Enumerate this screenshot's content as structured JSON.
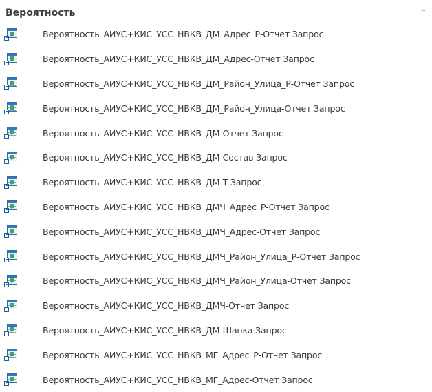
{
  "group": {
    "title": "Вероятность",
    "collapse_icon": "collapse-arrow-icon"
  },
  "items": [
    {
      "label": "Вероятность_АИУС+КИС_УСС_НВКВ_ДМ_Адрес_Р-Отчет Запрос",
      "icon": "query-shortcut-icon"
    },
    {
      "label": "Вероятность_АИУС+КИС_УСС_НВКВ_ДМ_Адрес-Отчет Запрос",
      "icon": "query-shortcut-icon"
    },
    {
      "label": "Вероятность_АИУС+КИС_УСС_НВКВ_ДМ_Район_Улица_Р-Отчет Запрос",
      "icon": "query-shortcut-icon"
    },
    {
      "label": "Вероятность_АИУС+КИС_УСС_НВКВ_ДМ_Район_Улица-Отчет Запрос",
      "icon": "query-shortcut-icon"
    },
    {
      "label": "Вероятность_АИУС+КИС_УСС_НВКВ_ДМ-Отчет Запрос",
      "icon": "query-shortcut-icon"
    },
    {
      "label": "Вероятность_АИУС+КИС_УСС_НВКВ_ДМ-Состав Запрос",
      "icon": "query-shortcut-icon"
    },
    {
      "label": "Вероятность_АИУС+КИС_УСС_НВКВ_ДМ-Т Запрос",
      "icon": "query-shortcut-icon"
    },
    {
      "label": "Вероятность_АИУС+КИС_УСС_НВКВ_ДМЧ_Адрес_Р-Отчет Запрос",
      "icon": "query-shortcut-icon"
    },
    {
      "label": "Вероятность_АИУС+КИС_УСС_НВКВ_ДМЧ_Адрес-Отчет Запрос",
      "icon": "query-shortcut-icon"
    },
    {
      "label": "Вероятность_АИУС+КИС_УСС_НВКВ_ДМЧ_Район_Улица_Р-Отчет Запрос",
      "icon": "query-shortcut-icon"
    },
    {
      "label": "Вероятность_АИУС+КИС_УСС_НВКВ_ДМЧ_Район_Улица-Отчет Запрос",
      "icon": "query-shortcut-icon"
    },
    {
      "label": "Вероятность_АИУС+КИС_УСС_НВКВ_ДМЧ-Отчет Запрос",
      "icon": "query-shortcut-icon"
    },
    {
      "label": "Вероятность_АИУС+КИС_УСС_НВКВ_ДМ-Шапка Запрос",
      "icon": "query-shortcut-icon"
    },
    {
      "label": "Вероятность_АИУС+КИС_УСС_НВКВ_МГ_Адрес_Р-Отчет Запрос",
      "icon": "query-shortcut-icon"
    },
    {
      "label": "Вероятность_АИУС+КИС_УСС_НВКВ_МГ_Адрес-Отчет Запрос",
      "icon": "query-shortcut-icon"
    }
  ]
}
